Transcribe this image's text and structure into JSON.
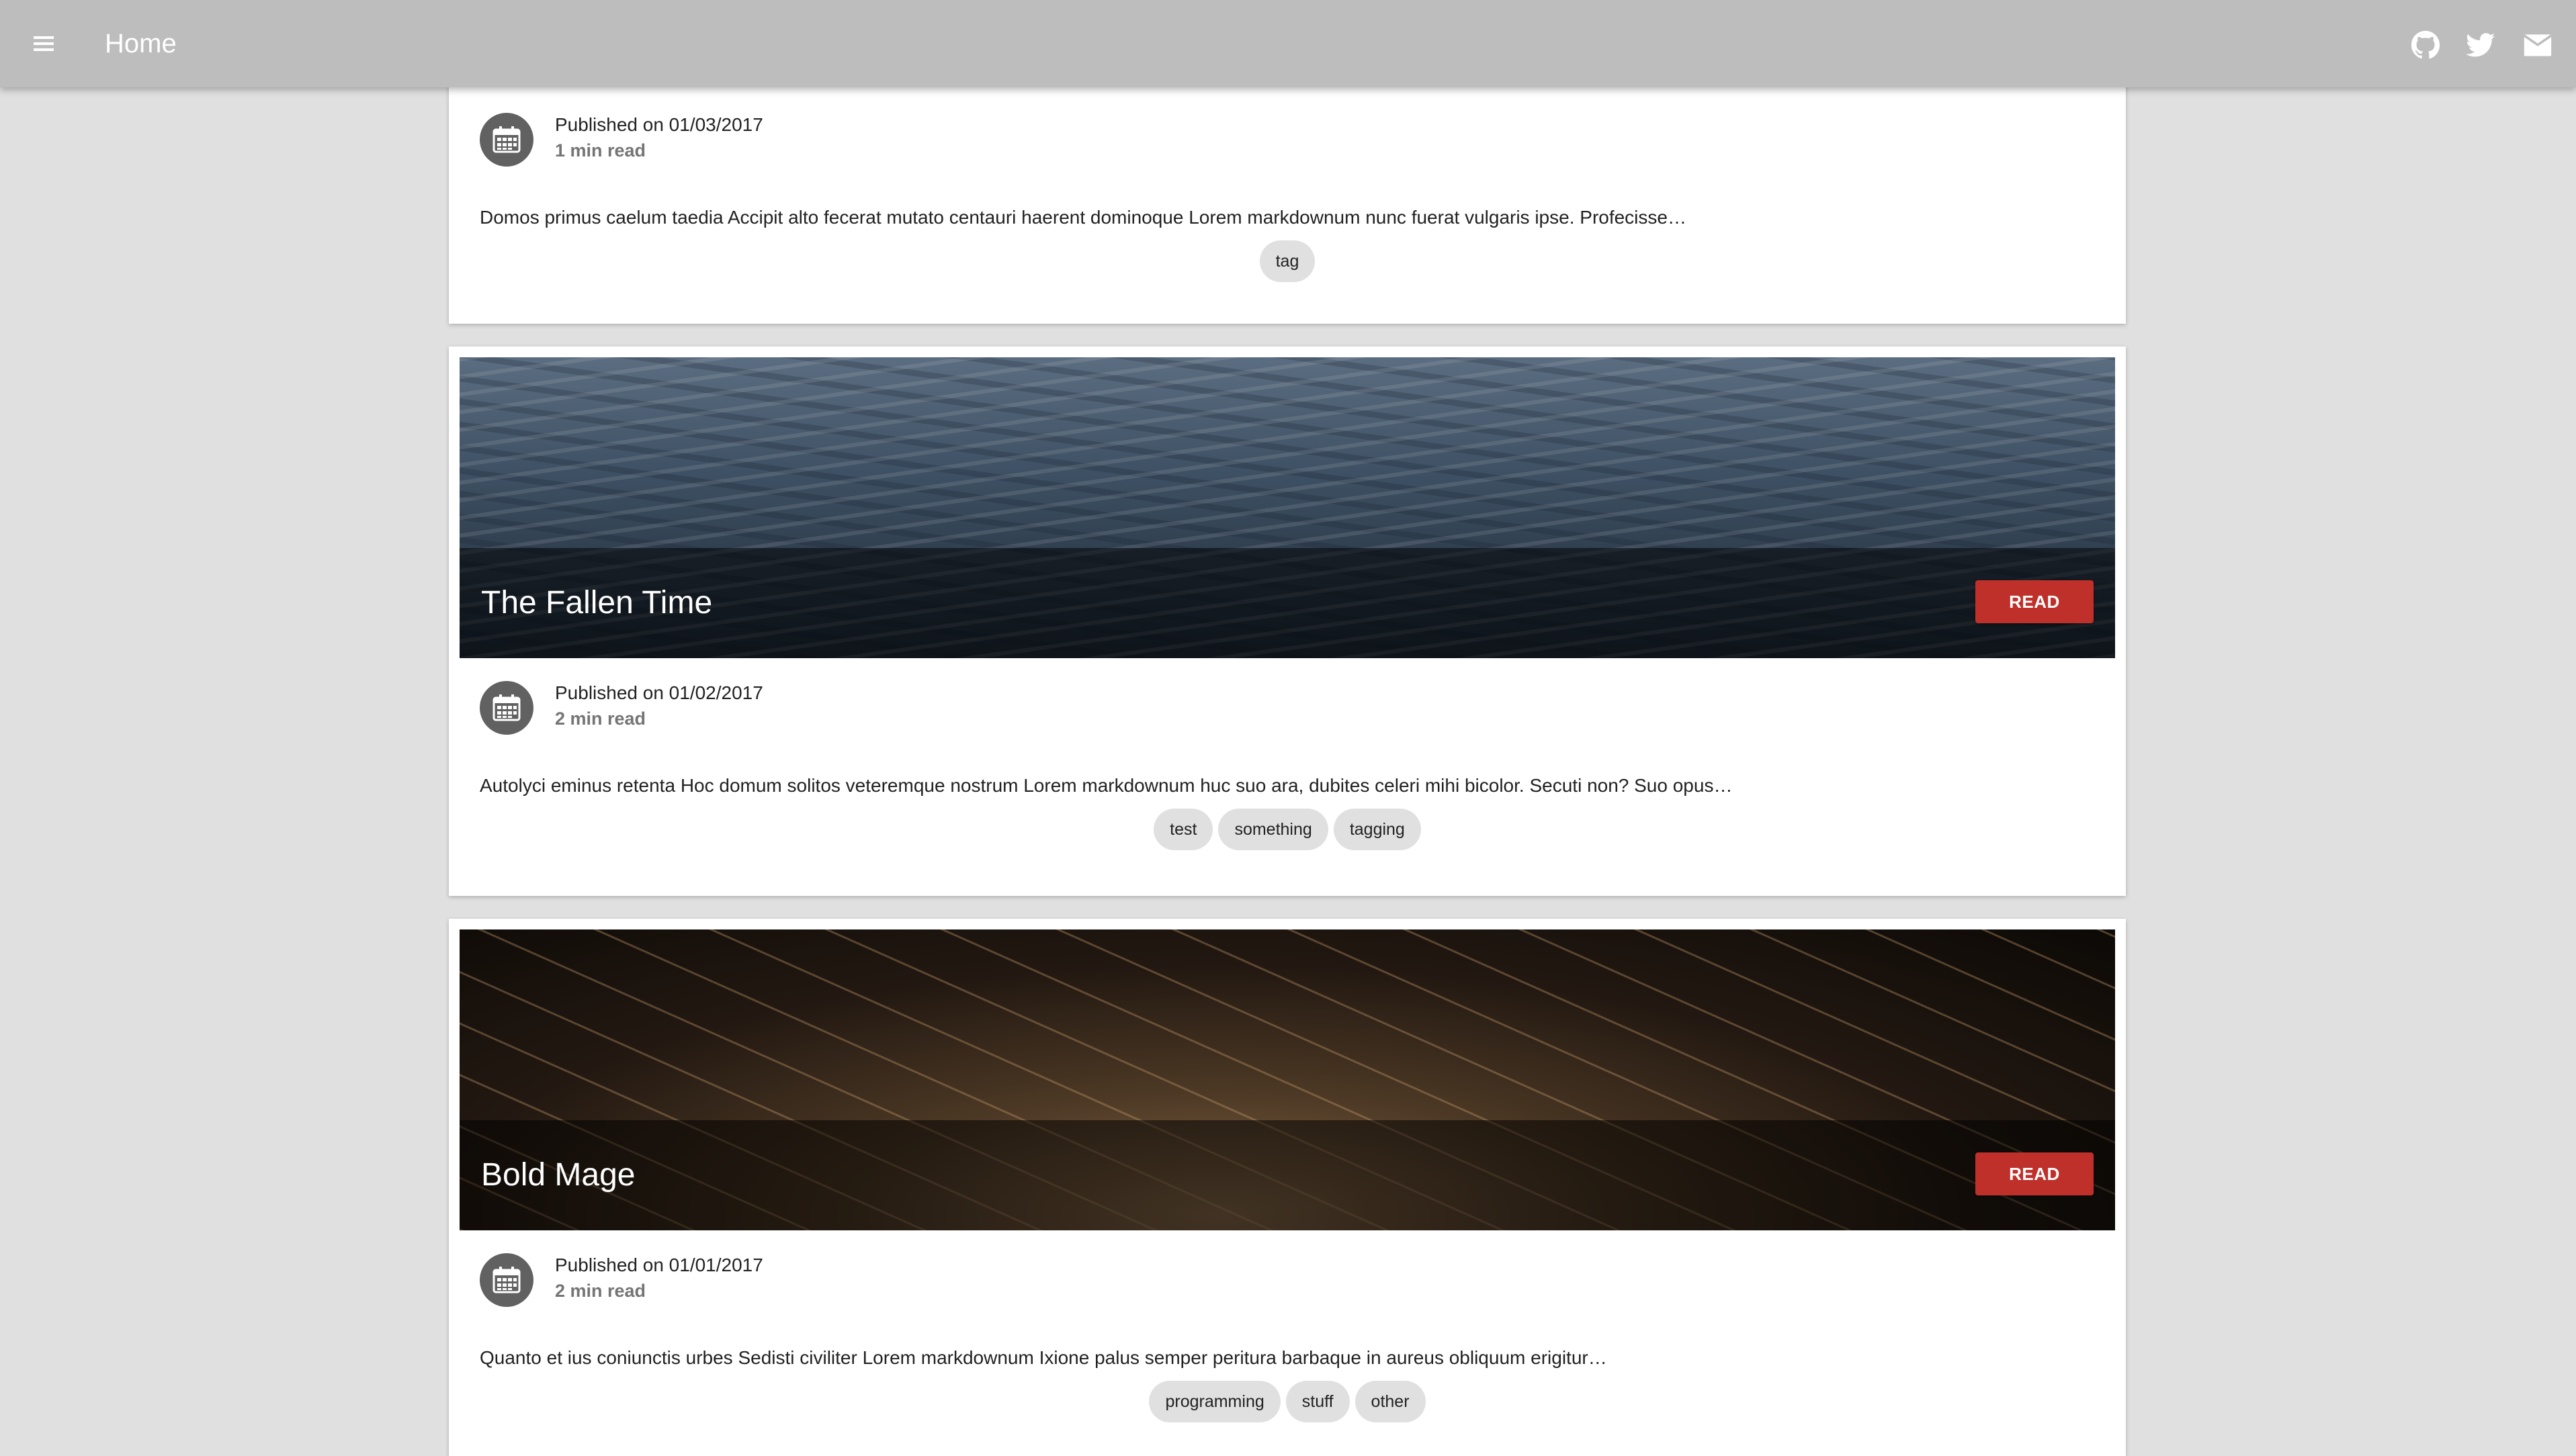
{
  "appbar": {
    "title": "Home",
    "icons": [
      "menu-icon",
      "github-icon",
      "twitter-icon",
      "email-icon"
    ]
  },
  "colors": {
    "appbar": "#bdbdbd",
    "background": "#e0e0e0",
    "read_button": "#c0302b",
    "chip": "#e0e0e0",
    "avatar": "#616161"
  },
  "posts": [
    {
      "published": "Published on 01/03/2017",
      "read_time": "1 min read",
      "excerpt": "Domos primus caelum taedia Accipit alto fecerat mutato centauri haerent dominoque Lorem markdownum nunc fuerat vulgaris ipse. Profecisse…",
      "tags": [
        "tag"
      ]
    },
    {
      "title": "The Fallen Time",
      "button": "Read",
      "published": "Published on 01/02/2017",
      "read_time": "2 min read",
      "excerpt": "Autolyci eminus retenta Hoc domum solitos veteremque nostrum Lorem markdownum huc suo ara, dubites celeri mihi bicolor. Secuti non? Suo opus…",
      "tags": [
        "test",
        "something",
        "tagging"
      ]
    },
    {
      "title": "Bold Mage",
      "button": "Read",
      "published": "Published on 01/01/2017",
      "read_time": "2 min read",
      "excerpt": "Quanto et ius coniunctis urbes Sedisti civiliter Lorem markdownum Ixione palus semper peritura barbaque in aureus obliquum erigitur…",
      "tags": [
        "programming",
        "stuff",
        "other"
      ]
    }
  ]
}
